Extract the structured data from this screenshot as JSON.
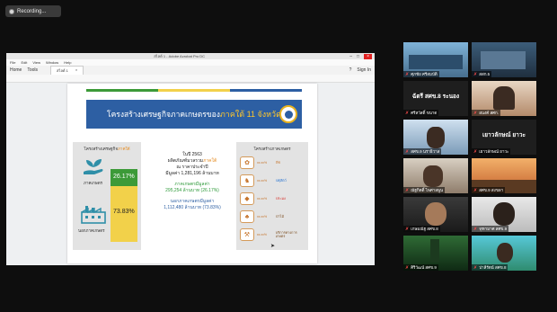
{
  "recording": {
    "label": "Recording..."
  },
  "viewer": {
    "title": "สไลด์ 1 - Adobe Acrobat Pro DC",
    "menu": [
      "File",
      "Edit",
      "View",
      "Window",
      "Help"
    ],
    "tabs": {
      "home": "Home",
      "tools": "Tools",
      "doc": "สไลด์ 1",
      "close": "×"
    },
    "help": "?",
    "signin": "Sign In",
    "window_controls": {
      "min": "–",
      "max": "□",
      "close": "×"
    }
  },
  "slide": {
    "banner_title": "โครงสร้างเศรษฐกิจภาคเกษตรของ",
    "banner_highlight": "ภาคใต้ 11 จังหวัด",
    "stripe_colors": [
      "#3c9a38",
      "#f2d14a",
      "#2d5fa3"
    ],
    "left_panel": {
      "title": "โครงสร้างเศรษฐกิจ",
      "title_highlight": "ภาคใต้",
      "agri_pct": "26.17%",
      "agri_label": "ภาคเกษตร",
      "nonagri_pct": "73.83%",
      "nonagri_label": "นอกภาคเกษตร"
    },
    "middle": {
      "line1": "ในปี 2563",
      "line2a": "ผลิตภัณฑ์มวลรวม",
      "line2b": "ภาคใต้",
      "line3": "ณ ราคาประจำปี",
      "line4": "มีมูลค่า 1,281,196 ล้านบาท",
      "agri_head": "ภาคเกษตรมีมูลค่า",
      "agri_value": "295,254 ล้านบาท (26.17%)",
      "nonagri_head": "นอกภาคเกษตรมีมูลค่า",
      "nonagri_value": "1,112,480 ล้านบาท (73.83%)"
    },
    "right_panel": {
      "title": "โครงสร้างภาคเกษตร",
      "items": [
        {
          "icon": "rubber-tree-icon",
          "pct": "xx.xx%",
          "name": "พืช",
          "color": "#c6742b"
        },
        {
          "icon": "livestock-icon",
          "pct": "xx.xx%",
          "name": "ปศุสัตว์",
          "color": "#1f6fd1"
        },
        {
          "icon": "fish-icon",
          "pct": "xx.xx%",
          "name": "ประมง",
          "color": "#d6261f"
        },
        {
          "icon": "forest-icon",
          "pct": "xx.xx%",
          "name": "ป่าไม้",
          "color": "#7a4a1c"
        },
        {
          "icon": "service-icon",
          "pct": "xx.xx%",
          "name": "บริการทางการเกษตร",
          "color": "#7a4a1c"
        }
      ]
    }
  },
  "participants": [
    {
      "name": "ศุภชัย ศรีสมบัติ",
      "kind": "video-room"
    },
    {
      "name": "สสก.5",
      "kind": "video-room2"
    },
    {
      "name": "ศรีสวัสดิ์ ขนาด",
      "kind": "text",
      "big": "ฉัตรี สศข.8 ระนอง"
    },
    {
      "name": "อนงค์ สศก.",
      "kind": "video-woman"
    },
    {
      "name": "สศข.9 นราธิวาส",
      "kind": "video-man"
    },
    {
      "name": "เยาวลักษณ์ ยาวะ",
      "kind": "text",
      "big": "เยาวลักษณ์ ยาวะ"
    },
    {
      "name": "ณัฐกิตติ์ ไพศาลพูน",
      "kind": "video-office"
    },
    {
      "name": "สศข.9 สงขลา",
      "kind": "video-sunset"
    },
    {
      "name": "เกษมณัฐ สศข.8",
      "kind": "video-face"
    },
    {
      "name": "จุฑามาศ สศข.9",
      "kind": "video-face2"
    },
    {
      "name": "ศิริวัฒน์ สศข.9",
      "kind": "video-forest"
    },
    {
      "name": "ปาลีรัตน์ สศข.8",
      "kind": "video-beach"
    }
  ]
}
